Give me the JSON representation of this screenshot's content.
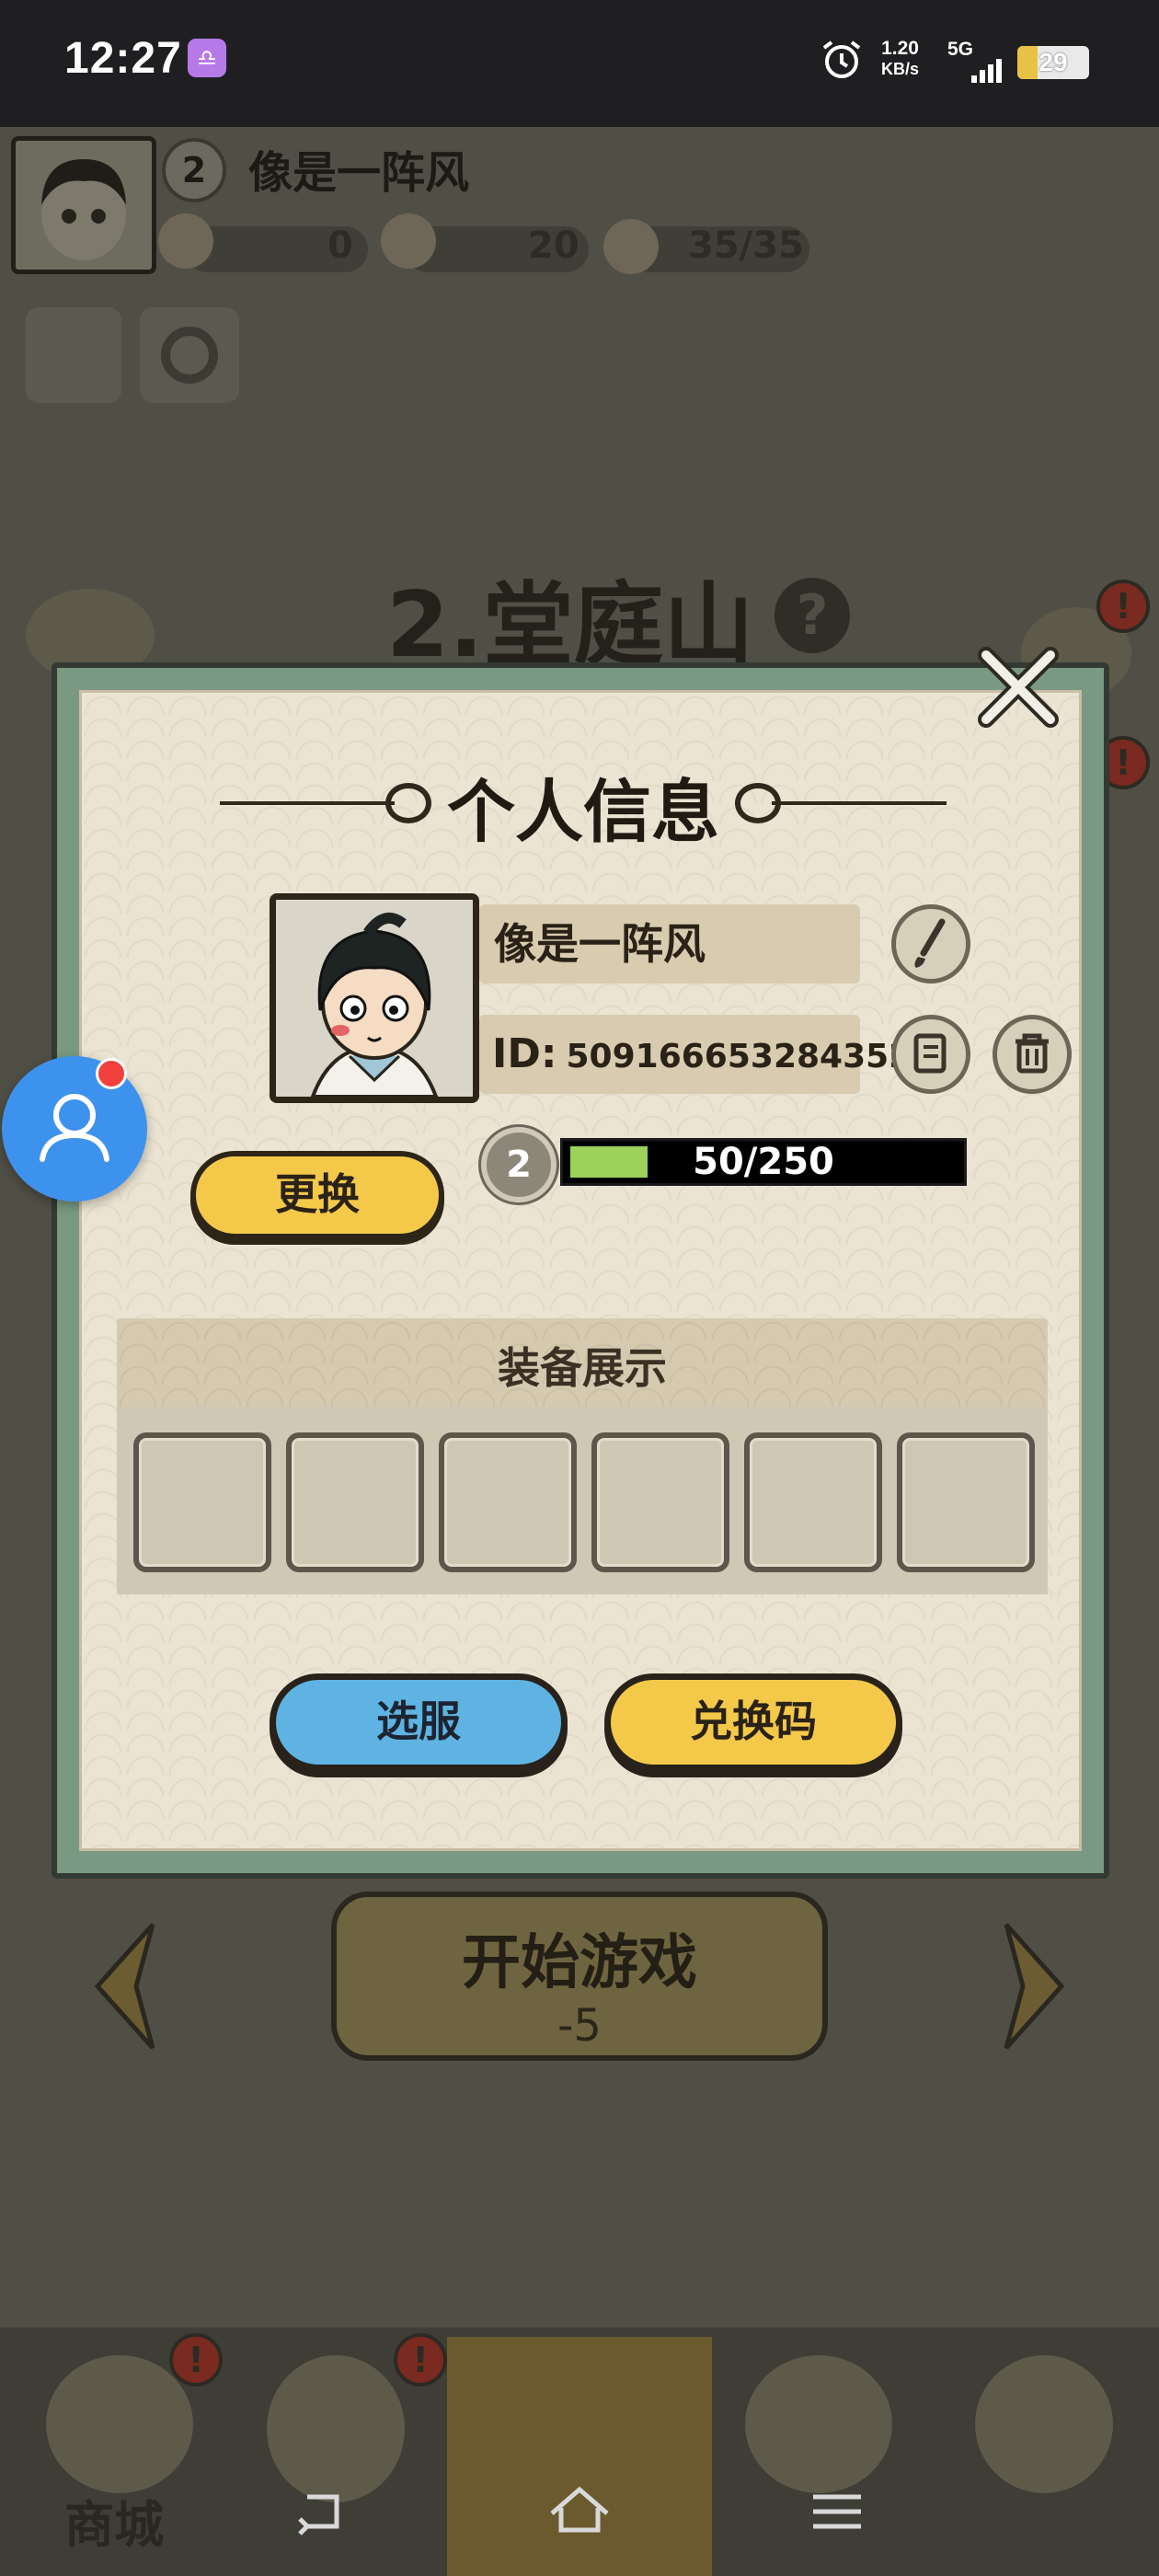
{
  "status_bar": {
    "time": "12:27",
    "app_badge": "♎",
    "net_speed_value": "1.20",
    "net_speed_unit": "KB/s",
    "net_type": "5G",
    "battery": "29"
  },
  "background": {
    "player_level": "2",
    "player_name": "像是一阵风",
    "resources": [
      {
        "icon": "coin-pouch-icon",
        "value": "0"
      },
      {
        "icon": "jade-dragon-icon",
        "value": "20"
      },
      {
        "icon": "peach-icon",
        "value": "35/35"
      }
    ],
    "stage_title": "2.堂庭山",
    "help": "?",
    "alert": "!",
    "start_button": {
      "label": "开始游戏",
      "cost": "-5"
    },
    "nav_label": "商城"
  },
  "dialog": {
    "title": "个人信息",
    "player_name": "像是一阵风",
    "id_label": "ID:",
    "id_value": "509166653284352",
    "level": "2",
    "xp_text": "50/250",
    "xp_progress": 0.2,
    "change_label": "更换",
    "equip_title": "装备展示",
    "equip_slot_count": 6,
    "server_label": "选服",
    "redeem_label": "兑换码"
  },
  "colors": {
    "accent_yellow": "#f4c94a",
    "accent_blue": "#5eb3e3",
    "dialog_frame": "#7a9982",
    "xp_green": "#9bd25a",
    "float_button": "#3d92ee"
  }
}
